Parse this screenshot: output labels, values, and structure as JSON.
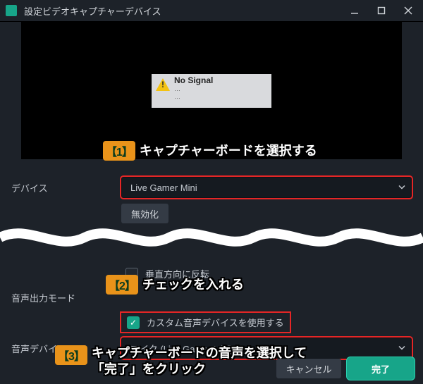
{
  "window": {
    "title": "設定ビデオキャプチャーデバイス"
  },
  "preview": {
    "no_signal_title": "No Signal",
    "no_signal_line1": "…",
    "no_signal_line2": "…"
  },
  "labels": {
    "device": "デバイス",
    "audio_output_mode": "音声出力モード",
    "audio_device": "音声デバイス"
  },
  "fields": {
    "device_select": "Live Gamer Mini",
    "disable_button": "無効化",
    "flip_vertical_label": "垂直方向に反転",
    "flip_vertical_checked": false,
    "use_custom_audio_label": "カスタム音声デバイスを使用する",
    "use_custom_audio_checked": true,
    "audio_device_select": "マイク (Live Gamer Mini)"
  },
  "footer": {
    "cancel": "キャンセル",
    "done": "完了"
  },
  "annotations": {
    "one_tag": "【1】",
    "one_text": "キャプチャーボードを選択する",
    "two_tag": "【2】",
    "two_text": "チェックを入れる",
    "three_tag": "【3】",
    "three_text": "キャプチャーボードの音声を選択して\n「完了」をクリック"
  }
}
